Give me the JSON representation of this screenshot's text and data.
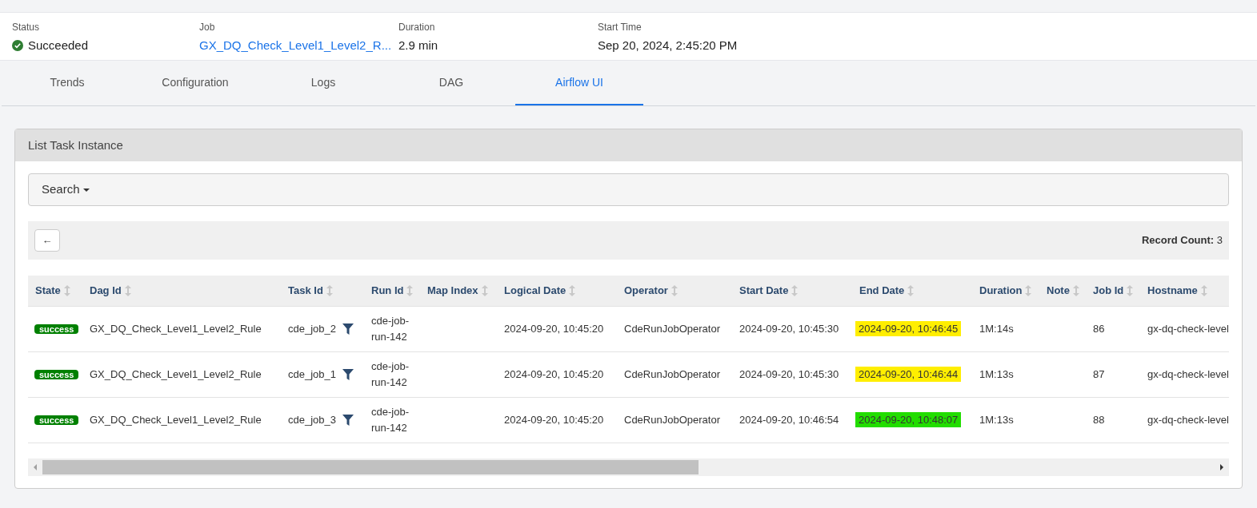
{
  "summary": [
    {
      "label": "Status",
      "value": "Succeeded",
      "kind": "status"
    },
    {
      "label": "Job",
      "value": "GX_DQ_Check_Level1_Level2_R...",
      "kind": "link"
    },
    {
      "label": "Duration",
      "value": "2.9 min",
      "kind": "text"
    },
    {
      "label": "Start Time",
      "value": "Sep 20, 2024, 2:45:20 PM",
      "kind": "text"
    }
  ],
  "tabs": [
    {
      "label": "Trends",
      "selected": false
    },
    {
      "label": "Configuration",
      "selected": false
    },
    {
      "label": "Logs",
      "selected": false
    },
    {
      "label": "DAG",
      "selected": false
    },
    {
      "label": "Airflow UI",
      "selected": true
    }
  ],
  "panel": {
    "title": "List Task Instance",
    "search": "Search",
    "back": "←",
    "record_count": "**Record Count:** 3"
  },
  "table": {
    "columns": [
      "State",
      "Dag Id",
      "Task Id",
      "Run Id",
      "Map Index",
      "Logical Date",
      "Operator",
      "Start Date",
      "End Date",
      "Duration",
      "Note",
      "Job Id",
      "Hostname"
    ],
    "rows": [
      {
        "state": "success",
        "dag_id": "GX_DQ_Check_Level1_Level2_Rule",
        "task_id": "cde_job_2",
        "run_id": "cde-job-run-142",
        "logical_date": "2024-09-20, 10:45:20",
        "operator": "CdeRunJobOperator",
        "start_date": "2024-09-20, 10:45:30",
        "end_date": "2024-09-20, 10:46:45",
        "color": "#ffee00",
        "duration": "1M:14s",
        "job_id": "86",
        "hostname": "gx-dq-check-level"
      },
      {
        "state": "success",
        "dag_id": "GX_DQ_Check_Level1_Level2_Rule",
        "task_id": "cde_job_1",
        "run_id": "cde-job-run-142",
        "logical_date": "2024-09-20, 10:45:20",
        "operator": "CdeRunJobOperator",
        "start_date": "2024-09-20, 10:45:30",
        "end_date": "2024-09-20, 10:46:44",
        "color": "#ffee00",
        "duration": "1M:13s",
        "job_id": "87",
        "hostname": "gx-dq-check-level"
      },
      {
        "state": "success",
        "dag_id": "GX_DQ_Check_Level1_Level2_Rule",
        "task_id": "cde_job_3",
        "run_id": "cde-job-run-142",
        "logical_date": "2024-09-20, 10:45:20",
        "operator": "CdeRunJobOperator",
        "start_date": "2024-09-20, 10:46:54",
        "end_date": "2024-09-20, 10:48:07",
        "color": "#22dd00",
        "duration": "1M:13s",
        "job_id": "88",
        "hostname": "gx-dq-check-level"
      }
    ]
  }
}
